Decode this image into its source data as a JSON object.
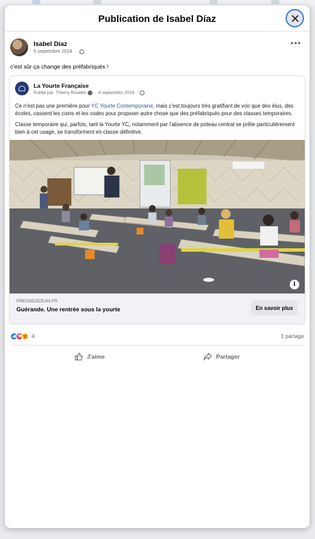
{
  "modal": {
    "title": "Publication de Isabel Díaz",
    "close_icon": "close-icon"
  },
  "post": {
    "author": "Isabel Díaz",
    "date": "5 septembre 2018",
    "privacy_icon": "globe-icon",
    "more_icon": "more-icon",
    "text": "c'est sûr ça change des préfabriqués !"
  },
  "shared": {
    "page_name": "La Yourte Française",
    "published_by_label": "Publié par",
    "published_by": "Thierry Rouelle",
    "date": "4 septembre 2018",
    "body_1_pre": "Ce n'est pas une première pour ",
    "body_1_link": "YC Yourte Contemporaine",
    "body_1_post": ", mais c'est toujours très gratifiant de voir que des élus, des écoles, cassent les coins et les codes pour proposer autre chose que des préfabriqués pour des classes temporaires.",
    "body_2": "Classe temporaire qui, parfois, tant la Yourte YC, notamment par l'absence de poteau central se prête particulièrement bien à cet usage, se transforment en classe définitive.",
    "link_domain": "PRESSEOCEAN.FR",
    "link_title": "Guérande. Une rentrée sous la yourte",
    "cta_label": "En savoir plus",
    "info_glyph": "i"
  },
  "stats": {
    "reaction_count": "4",
    "share_label": "1 partage",
    "reactions": [
      "like",
      "love",
      "wow"
    ],
    "colors": {
      "like": "#1877f2",
      "love": "#f33e58",
      "wow": "#f7b125"
    }
  },
  "actions": {
    "like_label": "J'aime",
    "share_label": "Partager"
  }
}
